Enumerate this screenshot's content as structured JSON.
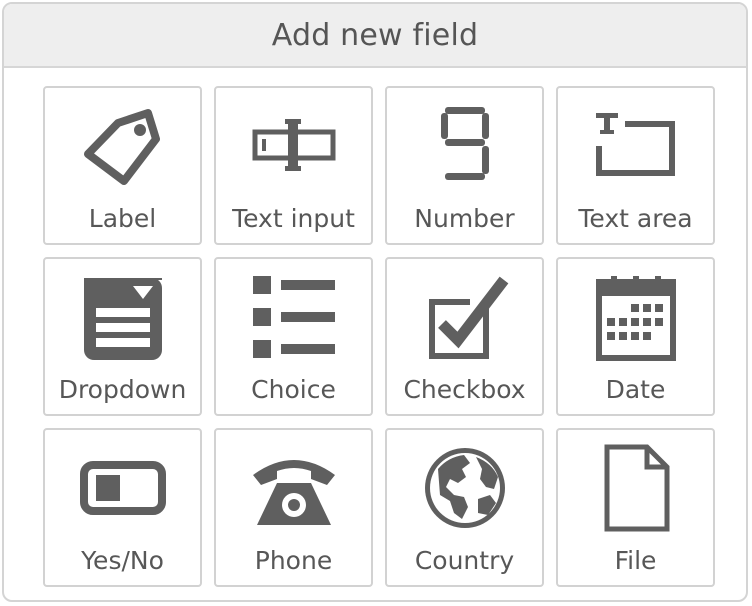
{
  "dialog": {
    "title": "Add new field",
    "fields": [
      {
        "label": "Label",
        "icon": "tag-icon"
      },
      {
        "label": "Text input",
        "icon": "text-input-icon"
      },
      {
        "label": "Number",
        "icon": "number-icon"
      },
      {
        "label": "Text area",
        "icon": "text-area-icon"
      },
      {
        "label": "Dropdown",
        "icon": "dropdown-icon"
      },
      {
        "label": "Choice",
        "icon": "list-icon"
      },
      {
        "label": "Checkbox",
        "icon": "checkbox-icon"
      },
      {
        "label": "Date",
        "icon": "calendar-icon"
      },
      {
        "label": "Yes/No",
        "icon": "toggle-icon"
      },
      {
        "label": "Phone",
        "icon": "phone-icon"
      },
      {
        "label": "Country",
        "icon": "globe-icon"
      },
      {
        "label": "File",
        "icon": "file-icon"
      }
    ]
  },
  "colors": {
    "icon": "#5f5f5f",
    "label": "#575757",
    "header_bg": "#eeeeee",
    "tile_border": "#d2d2d2"
  }
}
